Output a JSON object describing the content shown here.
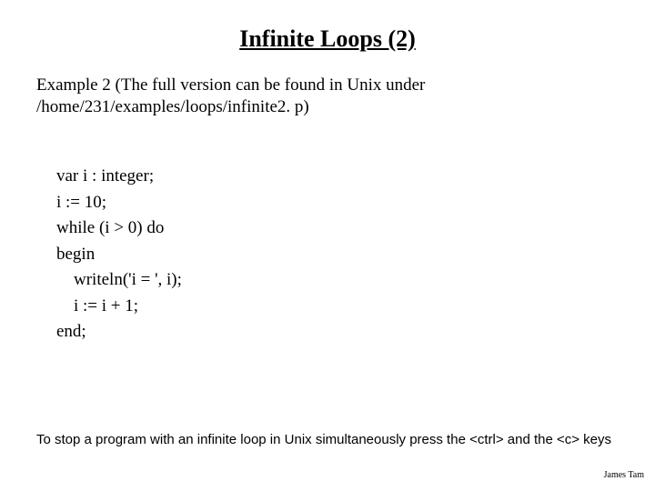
{
  "title": "Infinite Loops (2)",
  "intro_line1": "Example 2 (The full version can be found in Unix under",
  "intro_line2": "/home/231/examples/loops/infinite2. p)",
  "code": {
    "l1": "var i : integer;",
    "l2": "i := 10;",
    "l3": "while (i > 0) do",
    "l4": "begin",
    "l5": "    writeln('i = ', i);",
    "l6": "    i := i + 1;",
    "l7": "end;"
  },
  "footnote": "To stop a program with an infinite loop in Unix simultaneously press the  <ctrl> and the <c> keys",
  "author": "James Tam"
}
